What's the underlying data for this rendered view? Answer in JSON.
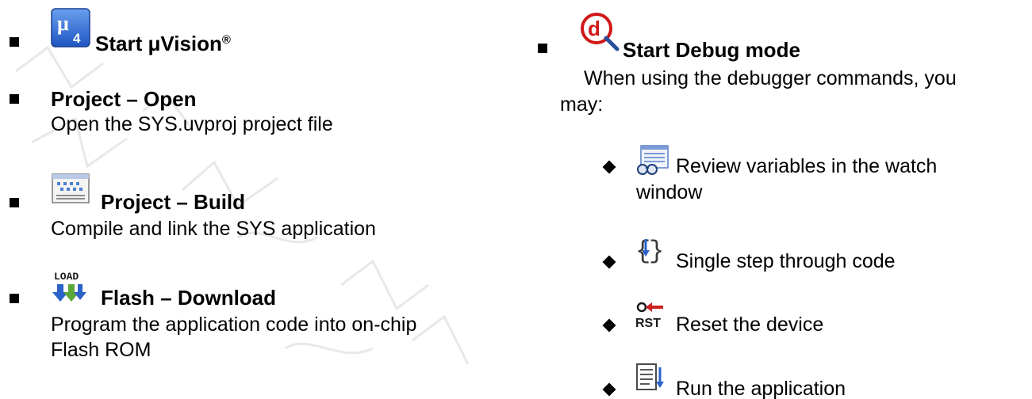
{
  "left": {
    "items": [
      {
        "title": "Start μVision",
        "title_sup": "®",
        "desc": []
      },
      {
        "title": "Project – Open",
        "desc": [
          "Open the SYS.uvproj project file"
        ]
      },
      {
        "title": "Project – Build",
        "desc": [
          "Compile and link the SYS application"
        ]
      },
      {
        "title": "Flash – Download",
        "icon_text": "LOAD",
        "desc": [
          "Program the application code into on-chip",
          "Flash ROM"
        ]
      }
    ]
  },
  "right": {
    "heading": "Start Debug mode",
    "intro": [
      "When using the debugger commands, you",
      "may:"
    ],
    "sub_items": [
      {
        "text": [
          "Review variables in the watch",
          "window"
        ]
      },
      {
        "text": [
          "Single step through code"
        ]
      },
      {
        "text": [
          "Reset the device"
        ],
        "icon_text": "RST"
      },
      {
        "text": [
          "Run the application"
        ]
      }
    ]
  },
  "icons": {
    "uvision": "uvision4-icon",
    "build": "build-icon",
    "download": "flash-download-icon",
    "debug": "start-debug-icon",
    "watch": "watch-window-icon",
    "step": "step-icon",
    "reset": "reset-icon",
    "run": "run-icon"
  },
  "colors": {
    "uvision_blue": "#2f6fd6",
    "debug_red": "#d01818",
    "reset_red": "#d02020",
    "arrow_blue": "#2a62c8",
    "arrow_green": "#5aa83a"
  }
}
